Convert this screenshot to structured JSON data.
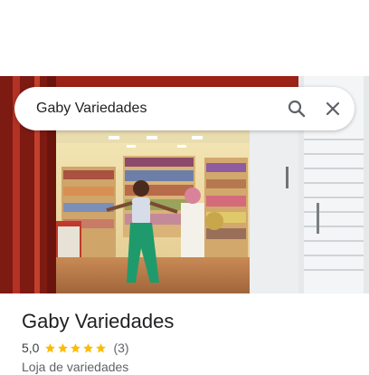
{
  "search": {
    "query": "Gaby Variedades"
  },
  "place": {
    "name": "Gaby Variedades",
    "rating": "5,0",
    "stars": 5,
    "review_count": "(3)",
    "category": "Loja de variedades"
  },
  "colors": {
    "star": "#fbbc04",
    "text": "#202124",
    "muted": "#5f6368"
  },
  "icons": {
    "search": "search-icon",
    "close": "close-icon"
  }
}
